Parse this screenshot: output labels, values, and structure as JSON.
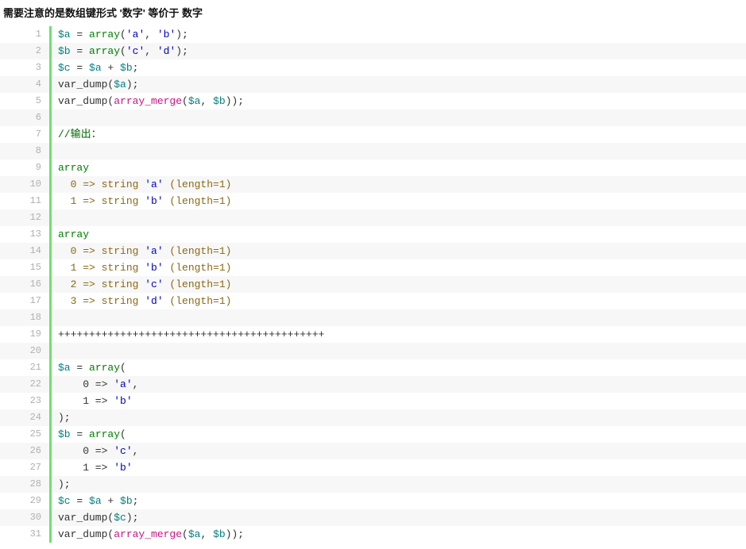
{
  "heading": "需要注意的是数组键形式 '数字' 等价于 数字",
  "lines": [
    {
      "n": 1,
      "tokens": [
        {
          "c": "tok-var",
          "t": "$a"
        },
        {
          "c": "tok-plain",
          "t": " = "
        },
        {
          "c": "tok-key",
          "t": "array"
        },
        {
          "c": "tok-plain",
          "t": "("
        },
        {
          "c": "tok-str",
          "t": "'a'"
        },
        {
          "c": "tok-plain",
          "t": ", "
        },
        {
          "c": "tok-str",
          "t": "'b'"
        },
        {
          "c": "tok-plain",
          "t": ");"
        }
      ]
    },
    {
      "n": 2,
      "tokens": [
        {
          "c": "tok-var",
          "t": "$b"
        },
        {
          "c": "tok-plain",
          "t": " = "
        },
        {
          "c": "tok-key",
          "t": "array"
        },
        {
          "c": "tok-plain",
          "t": "("
        },
        {
          "c": "tok-str",
          "t": "'c'"
        },
        {
          "c": "tok-plain",
          "t": ", "
        },
        {
          "c": "tok-str",
          "t": "'d'"
        },
        {
          "c": "tok-plain",
          "t": ");"
        }
      ]
    },
    {
      "n": 3,
      "tokens": [
        {
          "c": "tok-var",
          "t": "$c"
        },
        {
          "c": "tok-plain",
          "t": " = "
        },
        {
          "c": "tok-var",
          "t": "$a"
        },
        {
          "c": "tok-plain",
          "t": " + "
        },
        {
          "c": "tok-var",
          "t": "$b"
        },
        {
          "c": "tok-plain",
          "t": ";"
        }
      ]
    },
    {
      "n": 4,
      "tokens": [
        {
          "c": "tok-plain",
          "t": "var_dump("
        },
        {
          "c": "tok-var",
          "t": "$a"
        },
        {
          "c": "tok-plain",
          "t": ");"
        }
      ]
    },
    {
      "n": 5,
      "tokens": [
        {
          "c": "tok-plain",
          "t": "var_dump("
        },
        {
          "c": "tok-func",
          "t": "array_merge"
        },
        {
          "c": "tok-plain",
          "t": "("
        },
        {
          "c": "tok-var",
          "t": "$a"
        },
        {
          "c": "tok-plain",
          "t": ", "
        },
        {
          "c": "tok-var",
          "t": "$b"
        },
        {
          "c": "tok-plain",
          "t": "));"
        }
      ]
    },
    {
      "n": 6,
      "tokens": []
    },
    {
      "n": 7,
      "tokens": [
        {
          "c": "tok-cmt",
          "t": "//输出："
        }
      ]
    },
    {
      "n": 8,
      "tokens": []
    },
    {
      "n": 9,
      "tokens": [
        {
          "c": "tok-key",
          "t": "array"
        }
      ]
    },
    {
      "n": 10,
      "tokens": [
        {
          "c": "tok-brown",
          "t": "  0 => string "
        },
        {
          "c": "tok-str",
          "t": "'a'"
        },
        {
          "c": "tok-brown",
          "t": " (length=1)"
        }
      ]
    },
    {
      "n": 11,
      "tokens": [
        {
          "c": "tok-brown",
          "t": "  1 => string "
        },
        {
          "c": "tok-str",
          "t": "'b'"
        },
        {
          "c": "tok-brown",
          "t": " (length=1)"
        }
      ]
    },
    {
      "n": 12,
      "tokens": []
    },
    {
      "n": 13,
      "tokens": [
        {
          "c": "tok-key",
          "t": "array"
        }
      ]
    },
    {
      "n": 14,
      "tokens": [
        {
          "c": "tok-brown",
          "t": "  0 => string "
        },
        {
          "c": "tok-str",
          "t": "'a'"
        },
        {
          "c": "tok-brown",
          "t": " (length=1)"
        }
      ]
    },
    {
      "n": 15,
      "tokens": [
        {
          "c": "tok-brown",
          "t": "  1 => string "
        },
        {
          "c": "tok-str",
          "t": "'b'"
        },
        {
          "c": "tok-brown",
          "t": " (length=1)"
        }
      ]
    },
    {
      "n": 16,
      "tokens": [
        {
          "c": "tok-brown",
          "t": "  2 => string "
        },
        {
          "c": "tok-str",
          "t": "'c'"
        },
        {
          "c": "tok-brown",
          "t": " (length=1)"
        }
      ]
    },
    {
      "n": 17,
      "tokens": [
        {
          "c": "tok-brown",
          "t": "  3 => string "
        },
        {
          "c": "tok-str",
          "t": "'d'"
        },
        {
          "c": "tok-brown",
          "t": " (length=1)"
        }
      ]
    },
    {
      "n": 18,
      "tokens": []
    },
    {
      "n": 19,
      "tokens": [
        {
          "c": "tok-plain",
          "t": "+++++++++++++++++++++++++++++++++++++++++++"
        }
      ]
    },
    {
      "n": 20,
      "tokens": []
    },
    {
      "n": 21,
      "tokens": [
        {
          "c": "tok-var",
          "t": "$a"
        },
        {
          "c": "tok-plain",
          "t": " = "
        },
        {
          "c": "tok-key",
          "t": "array"
        },
        {
          "c": "tok-plain",
          "t": "("
        }
      ]
    },
    {
      "n": 22,
      "tokens": [
        {
          "c": "tok-plain",
          "t": "    0 => "
        },
        {
          "c": "tok-str",
          "t": "'a'"
        },
        {
          "c": "tok-plain",
          "t": ","
        }
      ]
    },
    {
      "n": 23,
      "tokens": [
        {
          "c": "tok-plain",
          "t": "    1 => "
        },
        {
          "c": "tok-str",
          "t": "'b'"
        }
      ]
    },
    {
      "n": 24,
      "tokens": [
        {
          "c": "tok-plain",
          "t": ");"
        }
      ]
    },
    {
      "n": 25,
      "tokens": [
        {
          "c": "tok-var",
          "t": "$b"
        },
        {
          "c": "tok-plain",
          "t": " = "
        },
        {
          "c": "tok-key",
          "t": "array"
        },
        {
          "c": "tok-plain",
          "t": "("
        }
      ]
    },
    {
      "n": 26,
      "tokens": [
        {
          "c": "tok-plain",
          "t": "    0 => "
        },
        {
          "c": "tok-str",
          "t": "'c'"
        },
        {
          "c": "tok-plain",
          "t": ","
        }
      ]
    },
    {
      "n": 27,
      "tokens": [
        {
          "c": "tok-plain",
          "t": "    1 => "
        },
        {
          "c": "tok-str",
          "t": "'b'"
        }
      ]
    },
    {
      "n": 28,
      "tokens": [
        {
          "c": "tok-plain",
          "t": ");"
        }
      ]
    },
    {
      "n": 29,
      "tokens": [
        {
          "c": "tok-var",
          "t": "$c"
        },
        {
          "c": "tok-plain",
          "t": " = "
        },
        {
          "c": "tok-var",
          "t": "$a"
        },
        {
          "c": "tok-plain",
          "t": " + "
        },
        {
          "c": "tok-var",
          "t": "$b"
        },
        {
          "c": "tok-plain",
          "t": ";"
        }
      ]
    },
    {
      "n": 30,
      "tokens": [
        {
          "c": "tok-plain",
          "t": "var_dump("
        },
        {
          "c": "tok-var",
          "t": "$c"
        },
        {
          "c": "tok-plain",
          "t": ");"
        }
      ]
    },
    {
      "n": 31,
      "tokens": [
        {
          "c": "tok-plain",
          "t": "var_dump("
        },
        {
          "c": "tok-func",
          "t": "array_merge"
        },
        {
          "c": "tok-plain",
          "t": "("
        },
        {
          "c": "tok-var",
          "t": "$a"
        },
        {
          "c": "tok-plain",
          "t": ", "
        },
        {
          "c": "tok-var",
          "t": "$b"
        },
        {
          "c": "tok-plain",
          "t": "));"
        }
      ]
    }
  ]
}
